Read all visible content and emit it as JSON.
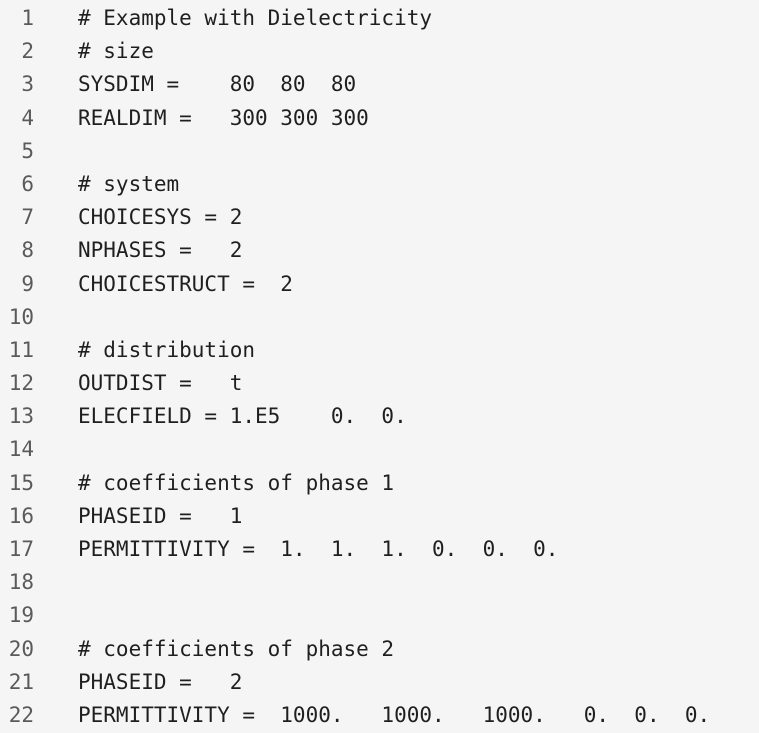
{
  "editor": {
    "lines": [
      {
        "num": "1",
        "text": "# Example with Dielectricity"
      },
      {
        "num": "2",
        "text": "# size"
      },
      {
        "num": "3",
        "text": "SYSDIM =    80  80  80"
      },
      {
        "num": "4",
        "text": "REALDIM =   300 300 300"
      },
      {
        "num": "5",
        "text": ""
      },
      {
        "num": "6",
        "text": "# system"
      },
      {
        "num": "7",
        "text": "CHOICESYS = 2"
      },
      {
        "num": "8",
        "text": "NPHASES =   2"
      },
      {
        "num": "9",
        "text": "CHOICESTRUCT =  2"
      },
      {
        "num": "10",
        "text": ""
      },
      {
        "num": "11",
        "text": "# distribution"
      },
      {
        "num": "12",
        "text": "OUTDIST =   t"
      },
      {
        "num": "13",
        "text": "ELECFIELD = 1.E5    0.  0."
      },
      {
        "num": "14",
        "text": ""
      },
      {
        "num": "15",
        "text": "# coefficients of phase 1"
      },
      {
        "num": "16",
        "text": "PHASEID =   1"
      },
      {
        "num": "17",
        "text": "PERMITTIVITY =  1.  1.  1.  0.  0.  0."
      },
      {
        "num": "18",
        "text": ""
      },
      {
        "num": "19",
        "text": ""
      },
      {
        "num": "20",
        "text": "# coefficients of phase 2"
      },
      {
        "num": "21",
        "text": "PHASEID =   2"
      },
      {
        "num": "22",
        "text": "PERMITTIVITY =  1000.   1000.   1000.   0.  0.  0."
      }
    ]
  }
}
